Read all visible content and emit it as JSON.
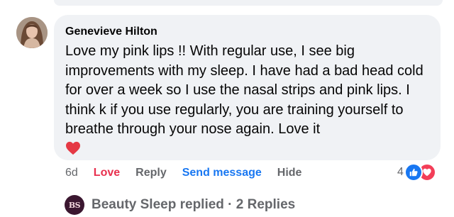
{
  "comment": {
    "author": "Genevieve Hilton",
    "text": "Love my pink lips !! With regular use, I see big improvements with my sleep. I have had a bad head cold for over a week so I use the nasal strips and pink lips. I think k if you use regularly, you are training yourself to breathe through your nose again. Love it",
    "emoji": "red-heart-icon",
    "time": "6d",
    "actions": {
      "love": "Love",
      "reply": "Reply",
      "send_message": "Send message",
      "hide": "Hide"
    },
    "reactions": {
      "count": "4",
      "types": [
        "like-icon",
        "love-icon"
      ]
    },
    "replies": {
      "page_avatar_text": "BS",
      "summary": "Beauty Sleep replied · 2 Replies"
    }
  },
  "colors": {
    "bubble": "#f0f2f5",
    "love_action": "#e8304e",
    "link_action": "#1877f2",
    "muted": "#65676b",
    "page_avatar": "#3b1730"
  }
}
